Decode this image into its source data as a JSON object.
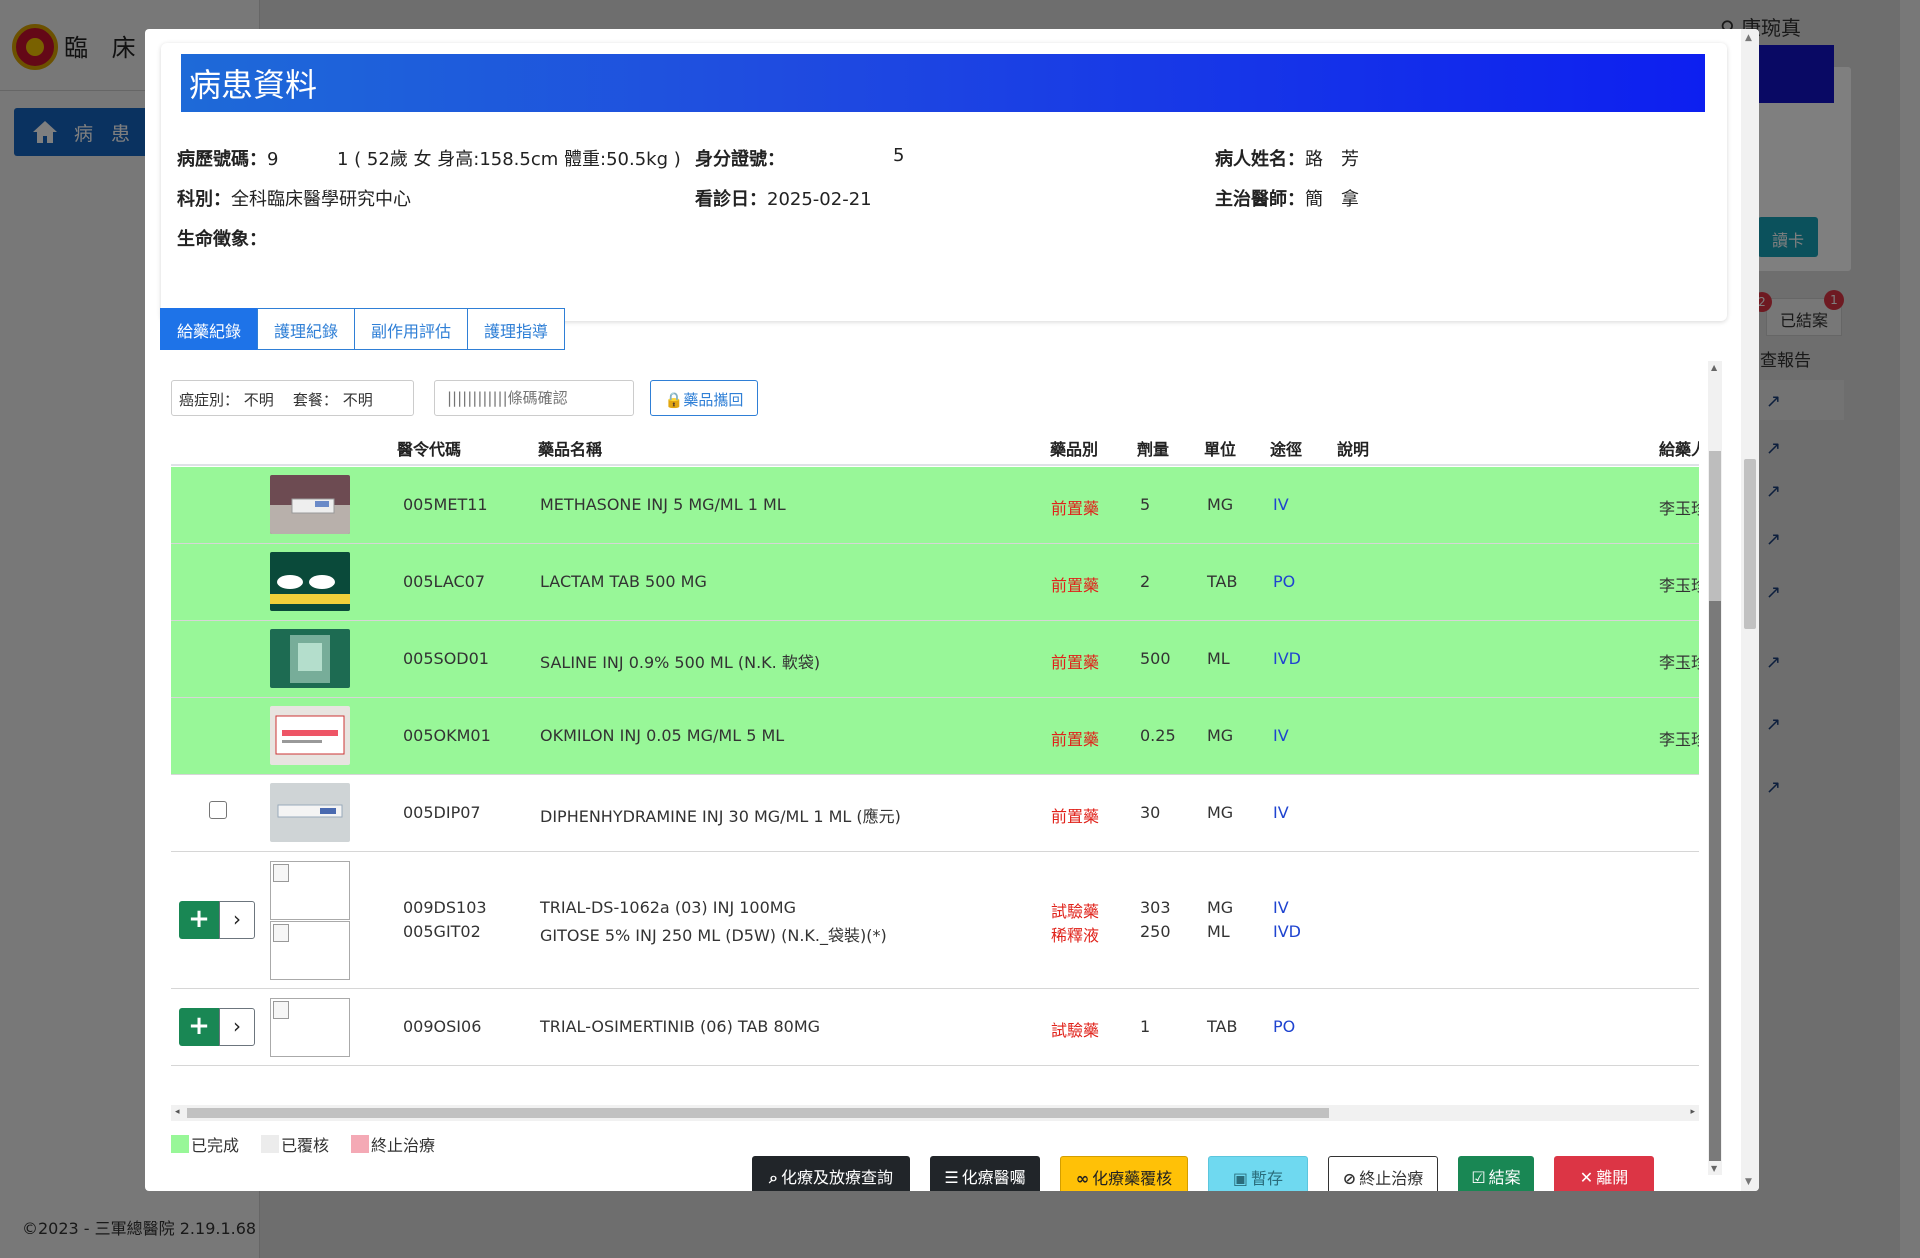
{
  "background": {
    "app_title": "臨 床 試",
    "nav_item": "病 患 清",
    "footer": "©2023 - 三軍總醫院 2.19.1.68",
    "user_name": "康琬真",
    "read_card_label": "讀卡",
    "closed_tab_label": "已結案",
    "closed_badge_left": "2",
    "closed_badge_right": "1",
    "report_label": "查報告"
  },
  "modal": {
    "title": "病患資料",
    "patient": {
      "record_label": "病歷號碼：",
      "record_value": "9",
      "record_suffix": "1 ( 52歲 女 身高:158.5cm 體重:50.5kg )",
      "id_label": "身分證號：",
      "id_value": "5",
      "name_label": "病人姓名：",
      "name_value": "路　芳",
      "dept_label": "科別：",
      "dept_value": "全科臨床醫學研究中心",
      "visit_label": "看診日：",
      "visit_value": "2025-02-21",
      "doctor_label": "主治醫師：",
      "doctor_value": "簡　拿",
      "vitals_label": "生命徵象："
    },
    "tabs": [
      {
        "label": "給藥紀錄",
        "active": true
      },
      {
        "label": "護理紀錄",
        "active": false
      },
      {
        "label": "副作用評估",
        "active": false
      },
      {
        "label": "護理指導",
        "active": false
      }
    ],
    "filter": {
      "cancer_label": "癌症別：",
      "cancer_value": "不明",
      "package_label": "套餐：",
      "package_value": "不明",
      "barcode_placeholder": "||||||||||||條碼確認",
      "return_button": "藥品攜回"
    },
    "table": {
      "headers": [
        "醫令代碼",
        "藥品名稱",
        "藥品別",
        "劑量",
        "單位",
        "途徑",
        "說明",
        "給藥人"
      ],
      "rows": [
        {
          "status": "done",
          "code": "005MET11",
          "name": "METHASONE INJ 5 MG/ML 1 ML",
          "kind": "前置藥",
          "dose": "5",
          "unit": "MG",
          "route": "IV",
          "note": "",
          "giver": "李玉珍"
        },
        {
          "status": "done",
          "code": "005LAC07",
          "name": "LACTAM TAB 500 MG",
          "kind": "前置藥",
          "dose": "2",
          "unit": "TAB",
          "route": "PO",
          "note": "",
          "giver": "李玉珍"
        },
        {
          "status": "done",
          "code": "005SOD01",
          "name": "SALINE INJ 0.9% 500 ML (N.K. 軟袋)",
          "kind": "前置藥",
          "dose": "500",
          "unit": "ML",
          "route": "IVD",
          "note": "",
          "giver": "李玉珍"
        },
        {
          "status": "done",
          "code": "005OKM01",
          "name": "OKMILON INJ 0.05 MG/ML 5 ML",
          "kind": "前置藥",
          "dose": "0.25",
          "unit": "MG",
          "route": "IV",
          "note": "",
          "giver": "李玉珍"
        },
        {
          "status": "pending",
          "code": "005DIP07",
          "name": "DIPHENHYDRAMINE INJ 30 MG/ML 1 ML (應元)",
          "kind": "前置藥",
          "dose": "30",
          "unit": "MG",
          "route": "IV",
          "note": "",
          "giver": ""
        },
        {
          "status": "group",
          "items": [
            {
              "code": "009DS103",
              "name": "TRIAL-DS-1062a (03) INJ 100MG",
              "kind": "試驗藥",
              "dose": "303",
              "unit": "MG",
              "route": "IV"
            },
            {
              "code": "005GIT02",
              "name": "GITOSE 5% INJ 250 ML (D5W) (N.K._袋裝)(*)",
              "kind": "稀釋液",
              "dose": "250",
              "unit": "ML",
              "route": "IVD"
            }
          ]
        },
        {
          "status": "group",
          "items": [
            {
              "code": "009OSI06",
              "name": "TRIAL-OSIMERTINIB (06) TAB 80MG",
              "kind": "試驗藥",
              "dose": "1",
              "unit": "TAB",
              "route": "PO"
            }
          ]
        }
      ]
    },
    "legend": [
      {
        "label": "已完成",
        "color": "#98f798"
      },
      {
        "label": "已覆核",
        "color": "#ececec"
      },
      {
        "label": "終止治療",
        "color": "#f4a9b5"
      }
    ],
    "buttons": {
      "chemo_query": "化療及放療查詢",
      "chemo_orders": "化療醫囑",
      "chemo_review": "化療藥覆核",
      "save": "暫存",
      "stop": "終止治療",
      "close_case": "結案",
      "leave": "離開"
    }
  }
}
